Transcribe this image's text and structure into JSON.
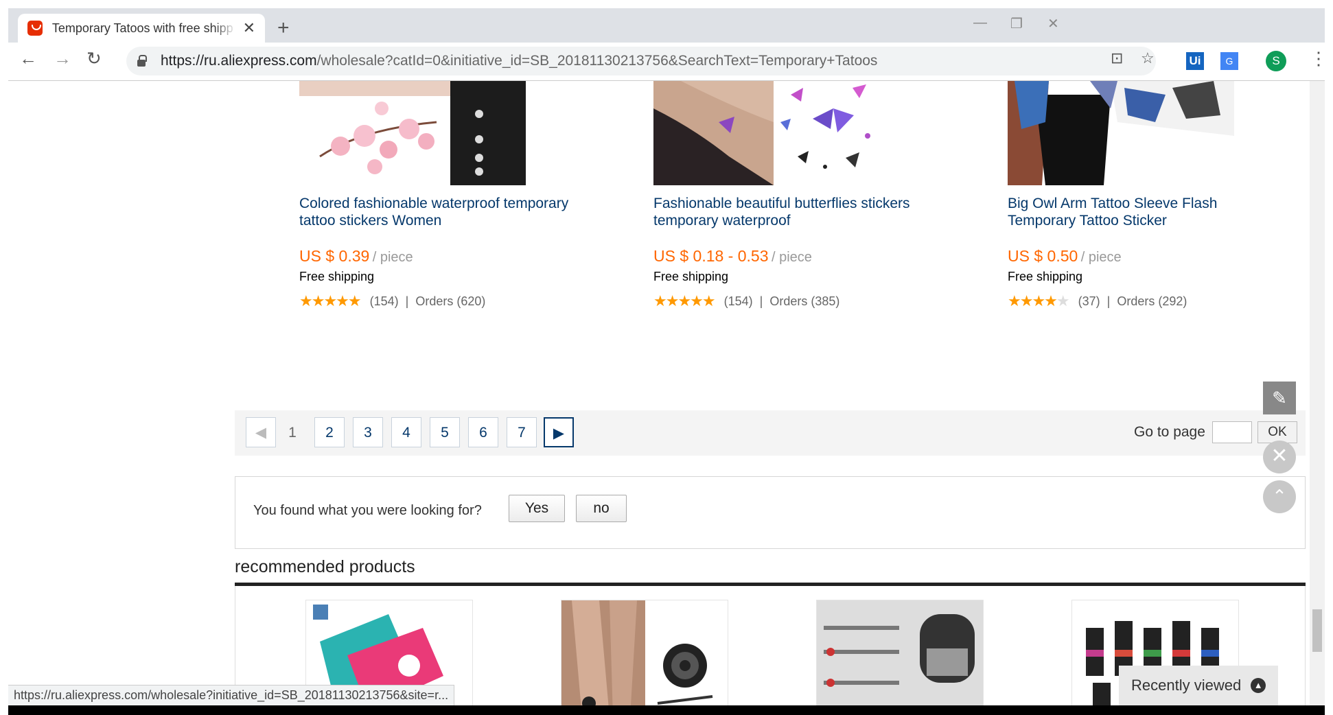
{
  "browser": {
    "tab_title": "Temporary Tatoos with free shipp",
    "tab_close": "✕",
    "new_tab": "+",
    "url_host": "https://ru.aliexpress.com",
    "url_path": "/wholesale?catId=0&initiative_id=SB_20181130213756&SearchText=Temporary+Tatoos",
    "status_url": "https://ru.aliexpress.com/wholesale?initiative_id=SB_20181130213756&site=r...",
    "avatar_letter": "S",
    "ext_ui": "Ui",
    "ext_translate": "G"
  },
  "products": [
    {
      "title": "Colored fashionable waterproof temporary tattoo stickers Women",
      "price": "US $ 0.39",
      "unit": "/ piece",
      "shipping": "Free shipping",
      "stars": 5,
      "reviews": "(154)",
      "orders": "Orders (620)"
    },
    {
      "title": "Fashionable beautiful butterflies stickers temporary waterproof",
      "price": "US $ 0.18 - 0.53",
      "unit": "/ piece",
      "shipping": "Free shipping",
      "stars": 5,
      "reviews": "(154)",
      "orders": "Orders (385)"
    },
    {
      "title": "Big Owl Arm Tattoo Sleeve Flash Temporary Tattoo Sticker",
      "price": "US $ 0.50",
      "unit": "/ piece",
      "shipping": "Free shipping",
      "stars": 4.5,
      "reviews": "(37)",
      "orders": "Orders (292)"
    }
  ],
  "pagination": {
    "pages": [
      "1",
      "2",
      "3",
      "4",
      "5",
      "6",
      "7"
    ],
    "current": "1",
    "goto_label": "Go to page",
    "ok_label": "OK"
  },
  "feedback": {
    "question": "You found what you were looking for?",
    "yes": "Yes",
    "no": "no"
  },
  "recommended": {
    "title": "recommended products"
  },
  "recently_viewed": "Recently viewed",
  "colors": {
    "price": "#ff6600",
    "title_link": "#05386b",
    "star": "#ff9900"
  }
}
